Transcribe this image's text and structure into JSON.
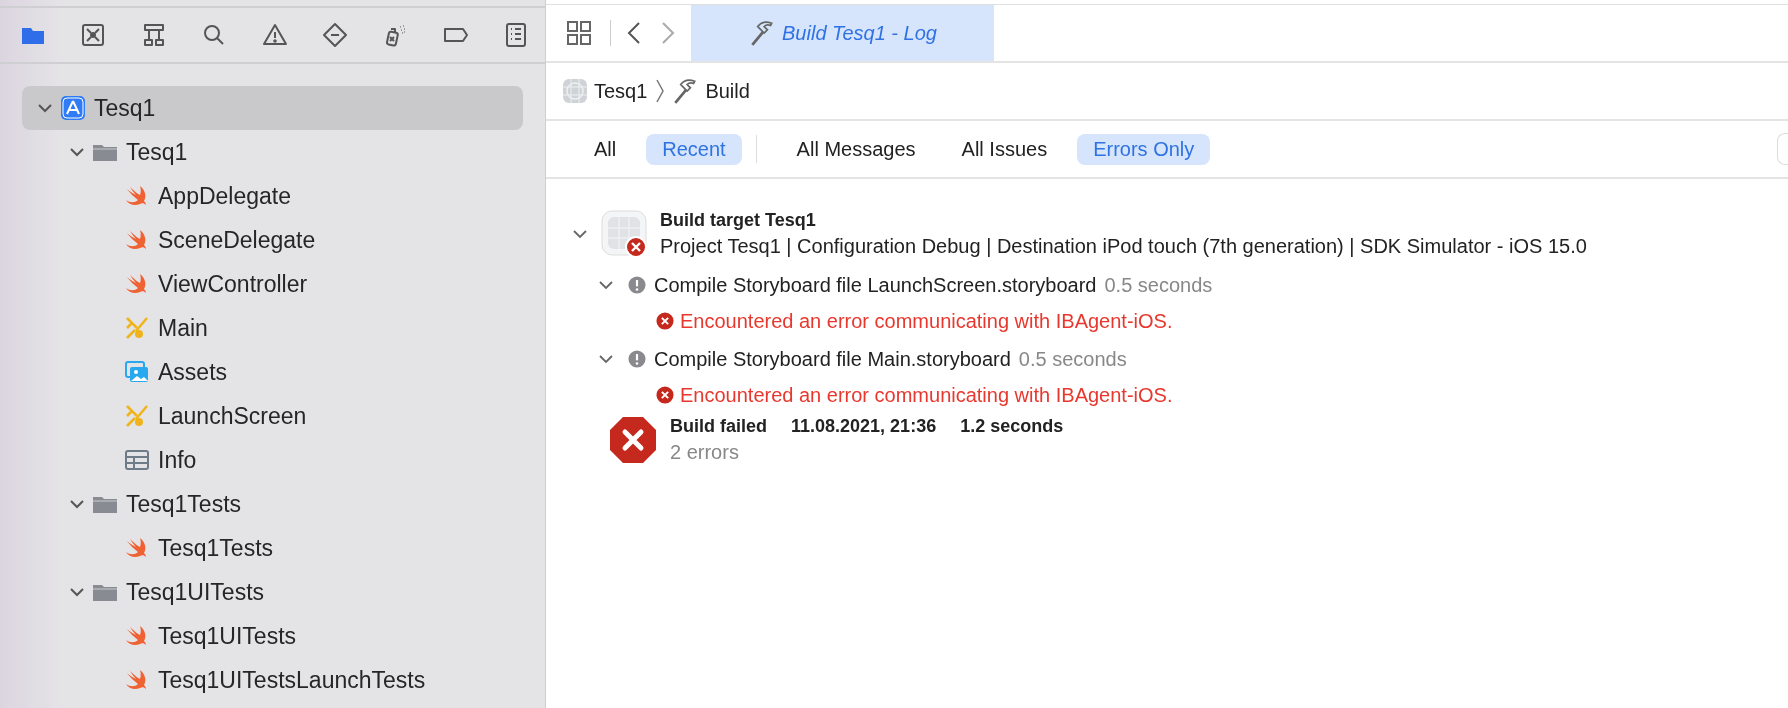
{
  "navigator_tabs": [
    {
      "kind": "project",
      "selected": true
    },
    {
      "kind": "source-control",
      "selected": false
    },
    {
      "kind": "symbols",
      "selected": false
    },
    {
      "kind": "find",
      "selected": false
    },
    {
      "kind": "issues",
      "selected": false
    },
    {
      "kind": "tests",
      "selected": false
    },
    {
      "kind": "debug",
      "selected": false
    },
    {
      "kind": "breakpoints",
      "selected": false
    },
    {
      "kind": "reports",
      "selected": false
    }
  ],
  "tree": [
    {
      "label": "Tesq1",
      "kind": "project",
      "expanded": true,
      "selected": true,
      "children": [
        {
          "label": "Tesq1",
          "kind": "folder",
          "expanded": true,
          "selected": false,
          "children": [
            {
              "label": "AppDelegate",
              "kind": "swift",
              "selected": false
            },
            {
              "label": "SceneDelegate",
              "kind": "swift",
              "selected": false
            },
            {
              "label": "ViewController",
              "kind": "swift",
              "selected": false
            },
            {
              "label": "Main",
              "kind": "storyboard",
              "selected": false
            },
            {
              "label": "Assets",
              "kind": "assets",
              "selected": false
            },
            {
              "label": "LaunchScreen",
              "kind": "storyboard",
              "selected": false
            },
            {
              "label": "Info",
              "kind": "plist",
              "selected": false
            }
          ]
        },
        {
          "label": "Tesq1Tests",
          "kind": "folder",
          "expanded": true,
          "selected": false,
          "children": [
            {
              "label": "Tesq1Tests",
              "kind": "swift",
              "selected": false
            }
          ]
        },
        {
          "label": "Tesq1UITests",
          "kind": "folder",
          "expanded": true,
          "selected": false,
          "children": [
            {
              "label": "Tesq1UITests",
              "kind": "swift",
              "selected": false
            },
            {
              "label": "Tesq1UITestsLaunchTests",
              "kind": "swift",
              "selected": false
            }
          ]
        }
      ]
    }
  ],
  "editor_tab": {
    "title": "Build Tesq1 - Log",
    "selected": true
  },
  "breadcrumb": [
    {
      "label": "Tesq1",
      "kind": "project"
    },
    {
      "label": "Build",
      "kind": "build"
    }
  ],
  "scope_filters": [
    {
      "label": "All",
      "selected": false
    },
    {
      "label": "Recent",
      "selected": true
    }
  ],
  "message_filters": [
    {
      "label": "All Messages",
      "selected": false
    },
    {
      "label": "All Issues",
      "selected": false
    },
    {
      "label": "Errors Only",
      "selected": true
    }
  ],
  "log": {
    "target": {
      "title": "Build target Tesq1",
      "description": "Project Tesq1 | Configuration Debug | Destination iPod touch (7th generation) | SDK Simulator - iOS 15.0",
      "expanded": true
    },
    "steps": [
      {
        "title": "Compile Storyboard file LaunchScreen.storyboard",
        "duration": "0.5 seconds",
        "expanded": true,
        "errors": [
          "Encountered an error communicating with IBAgent-iOS."
        ]
      },
      {
        "title": "Compile Storyboard file Main.storyboard",
        "duration": "0.5 seconds",
        "expanded": true,
        "errors": [
          "Encountered an error communicating with IBAgent-iOS."
        ]
      }
    ],
    "result": {
      "status": "Build failed",
      "date": "11.08.2021, 21:36",
      "duration": "1.2 seconds",
      "summary": "2 errors"
    }
  }
}
